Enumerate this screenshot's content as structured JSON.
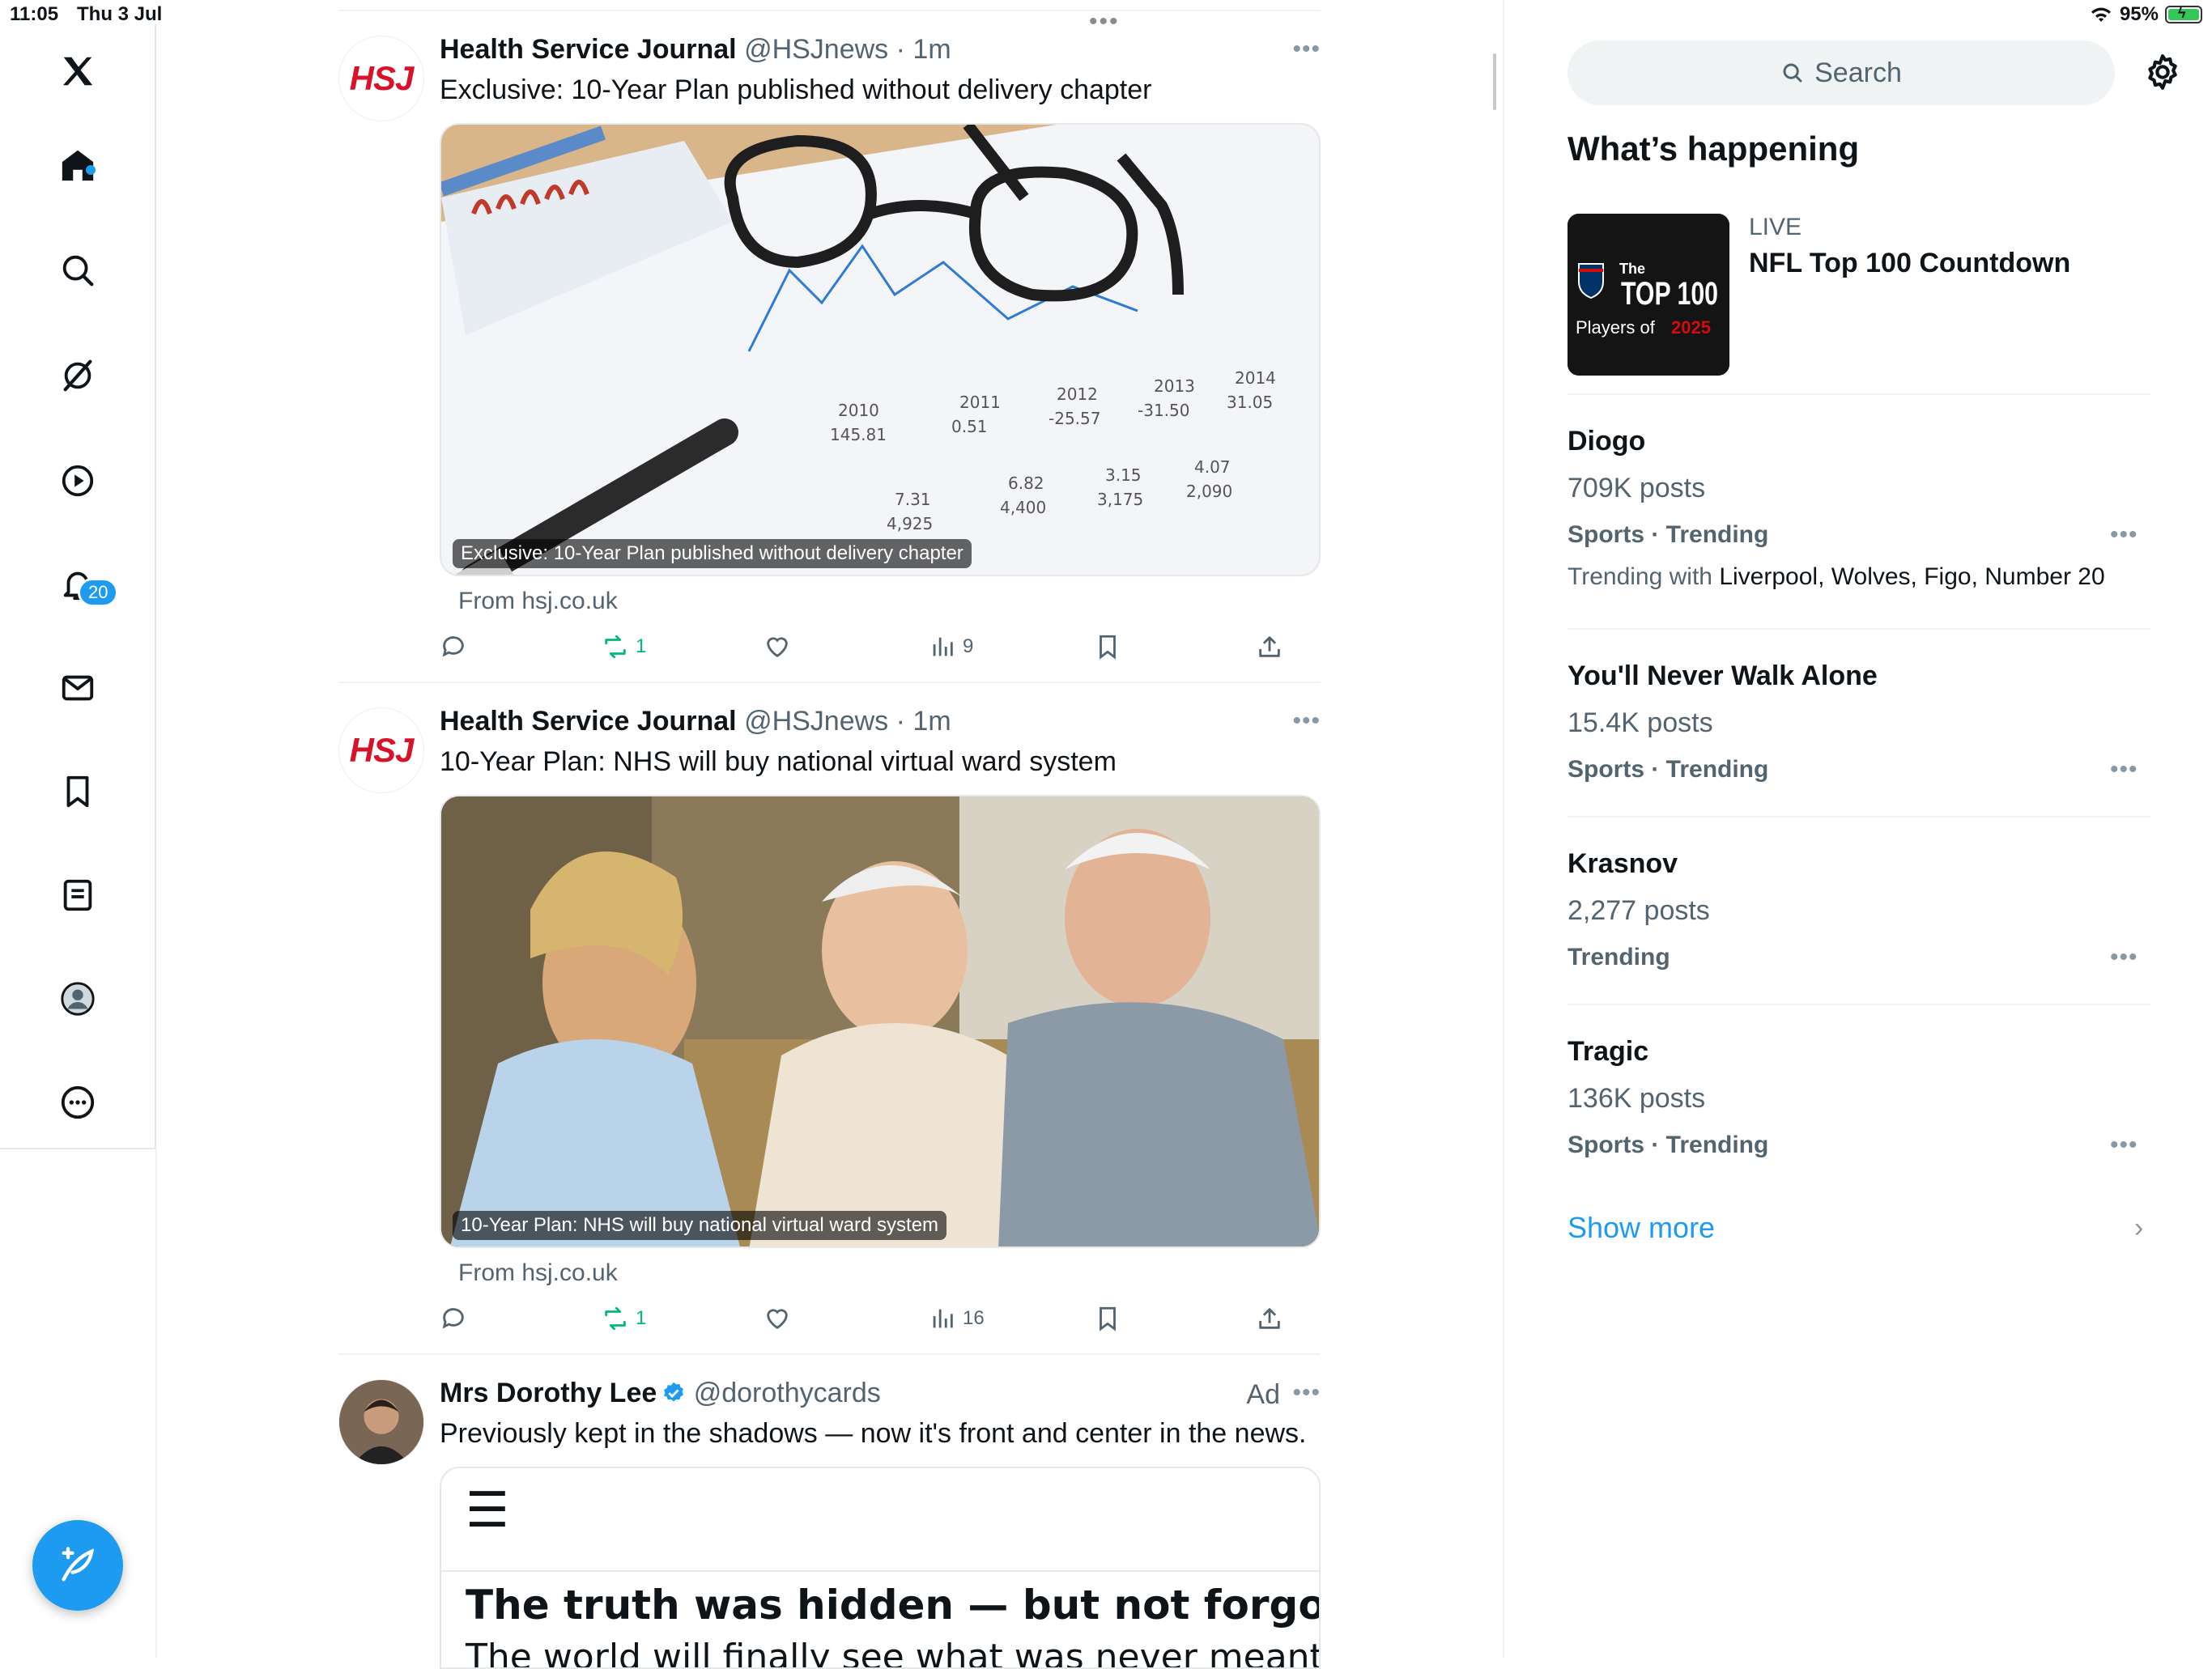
{
  "status_bar": {
    "time": "11:05",
    "date": "Thu 3 Jul",
    "battery": "95%",
    "battery_level": 0.95
  },
  "nav": {
    "items": [
      "home",
      "explore",
      "grok",
      "video",
      "notifications",
      "messages",
      "bookmarks",
      "lists",
      "profile",
      "more"
    ],
    "notification_count": "20"
  },
  "feed": {
    "tweets": [
      {
        "name": "Health Service Journal",
        "handle": "@HSJnews",
        "time": "· 1m",
        "avatar_text": "HSJ",
        "text": "Exclusive: 10-Year Plan published without delivery chapter",
        "media_caption": "Exclusive: 10-Year Plan published without delivery chapter",
        "from": "From hsj.co.uk",
        "retweets": "1",
        "views": "9"
      },
      {
        "name": "Health Service Journal",
        "handle": "@HSJnews",
        "time": "· 1m",
        "avatar_text": "HSJ",
        "text": "10-Year Plan: NHS will buy national virtual ward system",
        "media_caption": "10-Year Plan: NHS will buy national virtual ward system",
        "from": "From hsj.co.uk",
        "retweets": "1",
        "views": "16"
      },
      {
        "name": "Mrs Dorothy Lee",
        "handle": "@dorothycards",
        "ad_label": "Ad",
        "text": "Previously kept in the shadows — now it's front and center in the news.",
        "card_menu": "☰",
        "card_headline": "The truth was hidden — but not forgotten",
        "card_sub": "The world will finally see what was never meant"
      }
    ]
  },
  "right": {
    "search_placeholder": "Search",
    "whats_happening": "What’s happening",
    "live": {
      "label": "LIVE",
      "title": "NFL Top 100 Countdown",
      "thumb_top": "The",
      "thumb_main": "TOP 100",
      "thumb_sub": "Players of",
      "thumb_year": "2025"
    },
    "trends": [
      {
        "title": "Diogo",
        "count": "709K posts",
        "category": "Sports · Trending",
        "with_label": "Trending with",
        "with": "Liverpool, Wolves, Figo, Number 20"
      },
      {
        "title": "You'll Never Walk Alone",
        "count": "15.4K posts",
        "category": "Sports · Trending"
      },
      {
        "title": "Krasnov",
        "count": "2,277 posts",
        "category": "Trending"
      },
      {
        "title": "Tragic",
        "count": "136K posts",
        "category": "Sports · Trending"
      }
    ],
    "show_more": "Show more"
  },
  "colors": {
    "accent": "#1d9bf0",
    "retweet_green": "#00ba7c",
    "muted": "#536471",
    "hsj_red": "#d7132a"
  }
}
